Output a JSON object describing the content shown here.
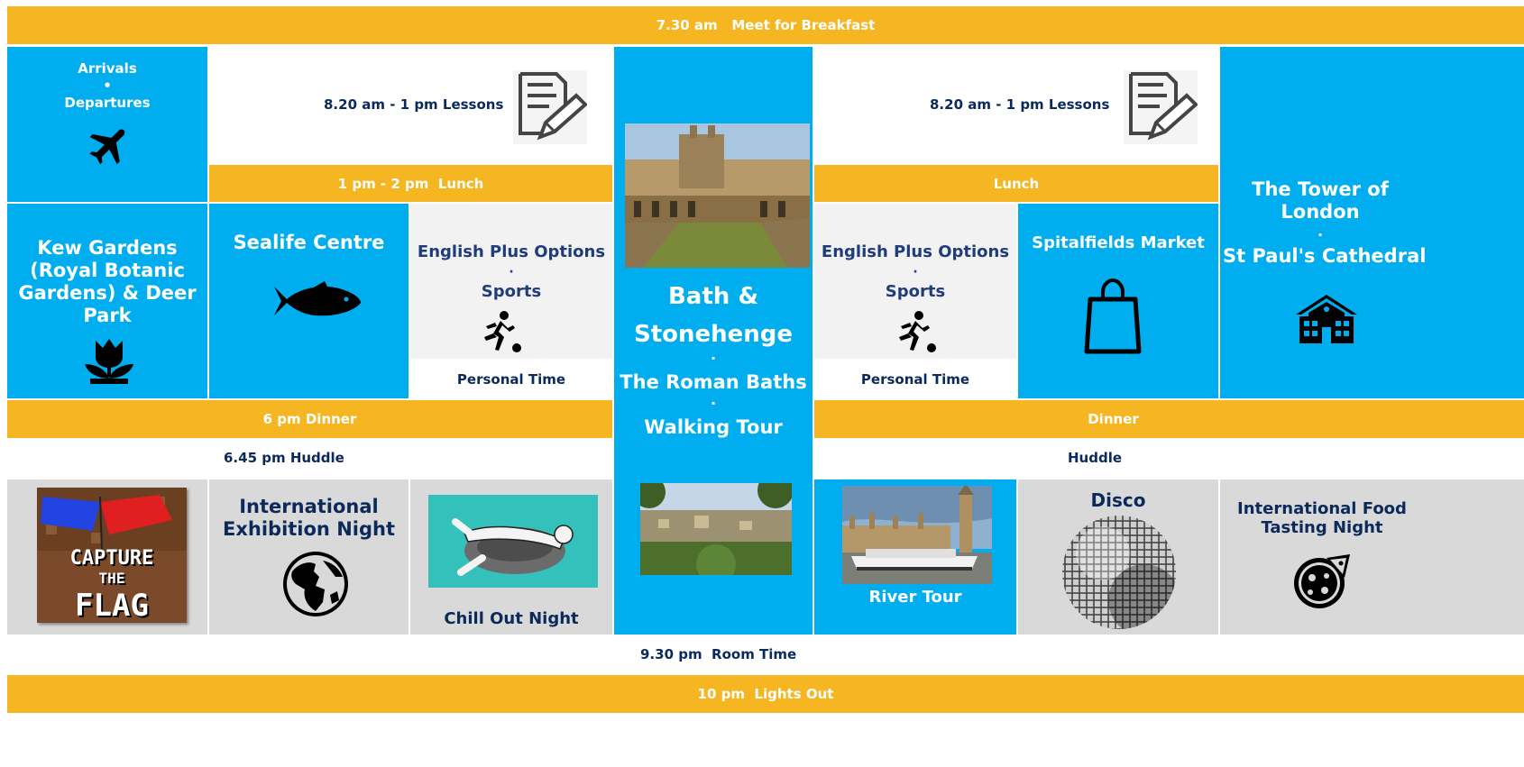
{
  "breakfast": "7.30 am   Meet for Breakfast",
  "arrivals": "Arrivals",
  "bullet": "•",
  "departures": "Departures",
  "lessons_1": "8.20 am - 1 pm  Lessons",
  "lessons_2": "8.20 am - 1 pm  Lessons",
  "lunch_1": "1 pm - 2 pm  Lunch",
  "lunch_2": "Lunch",
  "kew": "Kew Gardens (Royal Botanic Gardens) & Deer Park",
  "sealife": "Sealife Centre",
  "english_plus": "English Plus Options",
  "dot": "·",
  "sports": "Sports",
  "personal_time": "Personal Time",
  "bath": {
    "title_line1": "Bath &",
    "title_line2": "Stonehenge",
    "dot": "·",
    "roman_baths": "The Roman Baths",
    "walking_tour": "Walking Tour"
  },
  "spitalfields": "Spitalfields Market",
  "tower_line1": "The Tower of",
  "tower_line2": "London",
  "st_pauls": "St Paul's Cathedral",
  "dinner_1": "6 pm Dinner",
  "dinner_2": "Dinner",
  "huddle_1": "6.45 pm Huddle",
  "huddle_2": "Huddle",
  "ctf": {
    "line1": "CAPTURE",
    "line2": "THE",
    "line3": "FLAG"
  },
  "exhibition": "International Exhibition Night",
  "chill_out": "Chill Out Night",
  "river_tour": "River Tour",
  "disco": "Disco",
  "food_tasting": "International Food Tasting Night",
  "room_time": "9.30 pm  Room Time",
  "lights_out": "10 pm  Lights Out",
  "colors": {
    "orange": "#f5b622",
    "blue": "#00aeef",
    "navy": "#0b2a5a",
    "grey": "#f2f2f2"
  }
}
